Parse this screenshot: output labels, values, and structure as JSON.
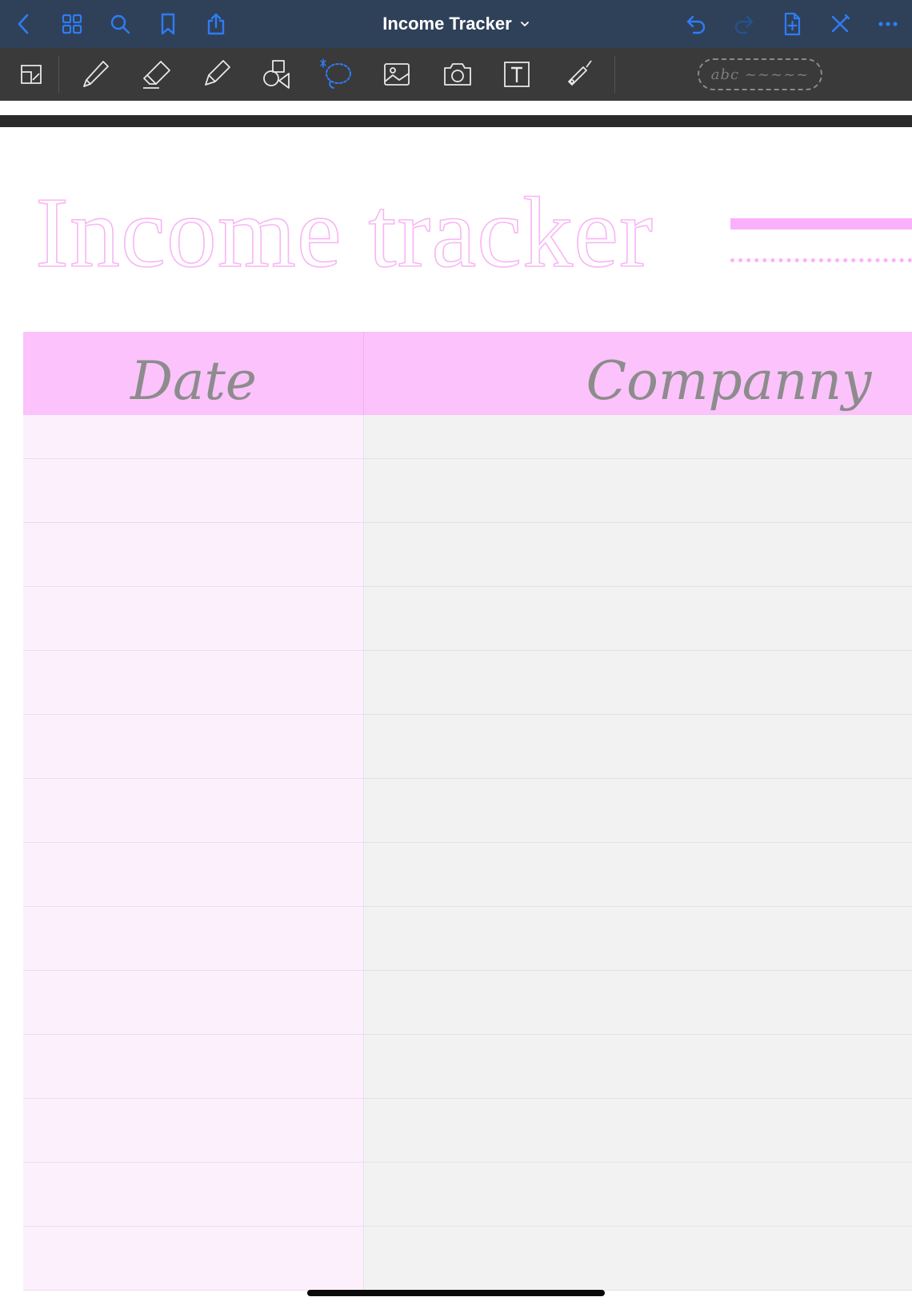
{
  "app": {
    "document_title": "Income Tracker",
    "accent_color": "#2f7cf6",
    "navbar_color": "#2f4159",
    "toolbar_color": "#3a3a3a"
  },
  "navbar": {
    "left_icons": [
      "back-chevron-icon",
      "thumbnails-grid-icon",
      "search-icon",
      "bookmark-icon",
      "share-icon"
    ],
    "right_icons": [
      "undo-icon",
      "redo-icon",
      "add-page-icon",
      "pen-off-icon",
      "more-icon"
    ]
  },
  "toolbar": {
    "tools": [
      "zoom-box-icon",
      "pen-icon",
      "eraser-icon",
      "highlighter-icon",
      "shapes-icon",
      "lasso-icon",
      "image-icon",
      "camera-icon",
      "text-icon",
      "laser-pointer-icon"
    ],
    "selected_tool": "lasso-icon",
    "ink_pill": "abc ~~~~~"
  },
  "page": {
    "title": "Income tracker",
    "title_color": "#f8b6f4",
    "columns": [
      "Date",
      "Companny"
    ],
    "header_color": "#fbc2fb",
    "rows": 14
  }
}
